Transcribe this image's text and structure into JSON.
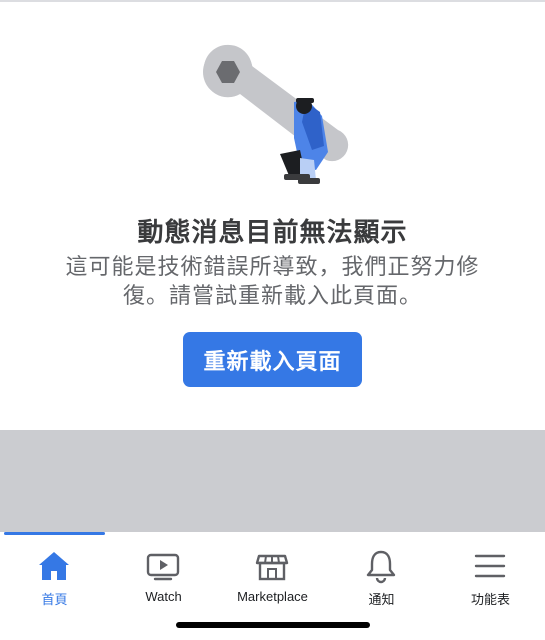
{
  "error": {
    "title": "動態消息目前無法顯示",
    "message": "這可能是技術錯誤所導致，我們正努力修復。請嘗試重新載入此頁面。",
    "reload_label": "重新載入頁面"
  },
  "tabs": [
    {
      "label": "首頁",
      "icon": "home-icon",
      "active": true
    },
    {
      "label": "Watch",
      "icon": "watch-icon",
      "active": false
    },
    {
      "label": "Marketplace",
      "icon": "marketplace-icon",
      "active": false
    },
    {
      "label": "通知",
      "icon": "bell-icon",
      "active": false
    },
    {
      "label": "功能表",
      "icon": "menu-icon",
      "active": false
    }
  ],
  "colors": {
    "accent": "#3578e5",
    "title_text": "#3a3b3d",
    "body_text": "#65676b",
    "gray_area": "#cbccd0",
    "tab_inactive": "#5f6065"
  }
}
